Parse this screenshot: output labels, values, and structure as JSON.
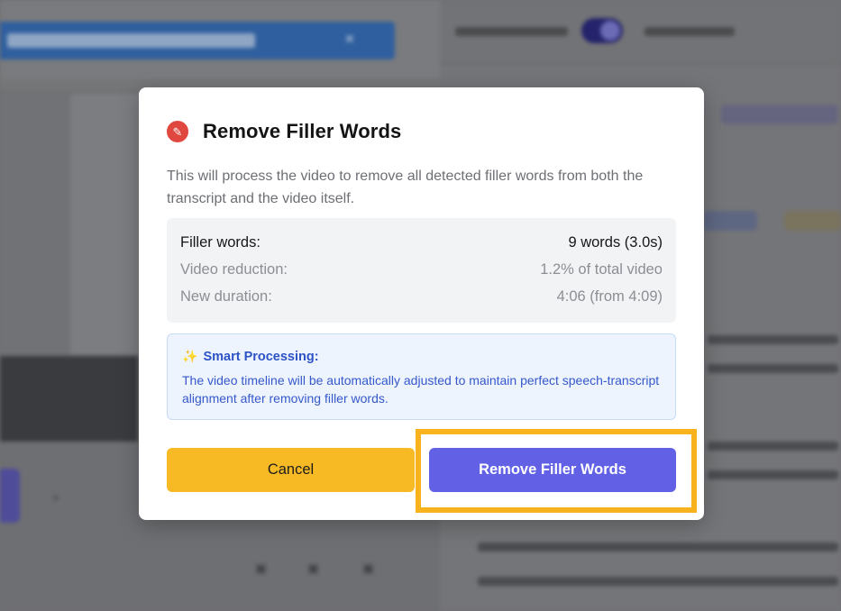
{
  "modal": {
    "title": "Remove Filler Words",
    "title_icon": "magic-wand-icon",
    "description": "This will process the video to remove all detected filler words from both the transcript and the video itself.",
    "stats": [
      {
        "label": "Filler words:",
        "value": "9 words (3.0s)"
      },
      {
        "label": "Video reduction:",
        "value": "1.2% of total video"
      },
      {
        "label": "New duration:",
        "value": "4:06 (from 4:09)"
      }
    ],
    "info": {
      "icon": "sparkles-icon",
      "title": "Smart Processing:",
      "text": "The video timeline will be automatically adjusted to maintain perfect speech-transcript alignment after removing filler words."
    },
    "buttons": {
      "cancel": "Cancel",
      "remove": "Remove Filler Words"
    }
  },
  "colors": {
    "title_icon_bg": "#e0473e",
    "cancel_bg": "#f7b924",
    "remove_bg": "#6261e6",
    "info_text": "#3558cc",
    "highlight": "#f7b21c"
  }
}
